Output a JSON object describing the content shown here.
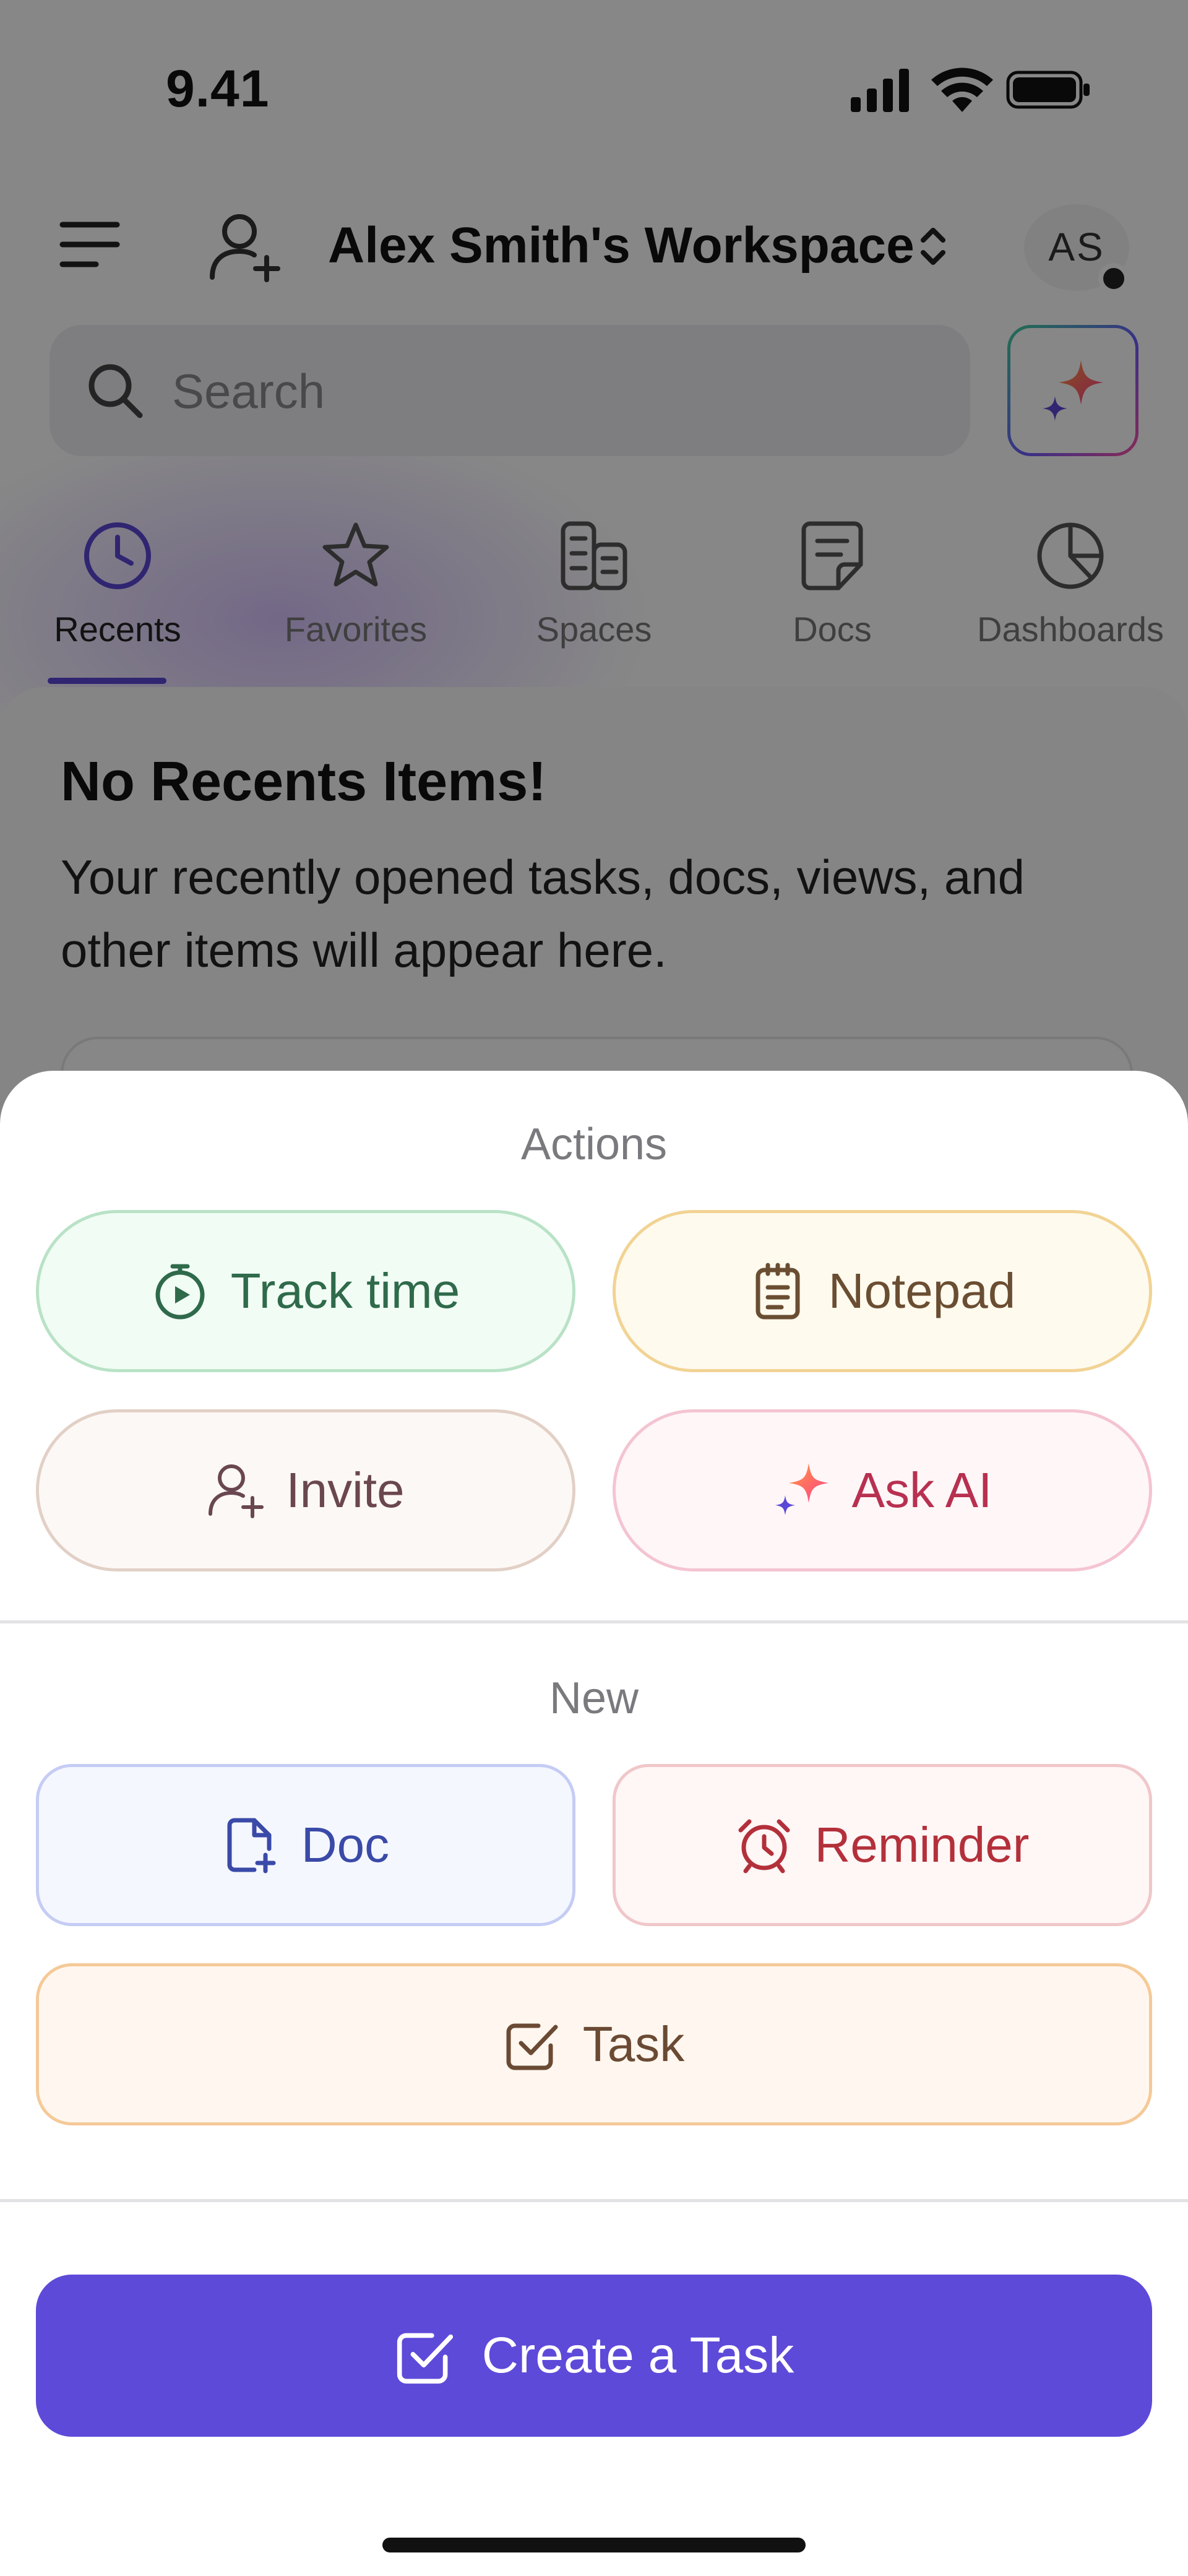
{
  "status_bar": {
    "time": "9.41"
  },
  "header": {
    "workspace_name": "Alex Smith's Workspace",
    "avatar_initials": "AS"
  },
  "search": {
    "placeholder": "Search"
  },
  "nav_tabs": [
    {
      "label": "Recents",
      "icon": "clock-icon",
      "active": true
    },
    {
      "label": "Favorites",
      "icon": "star-icon",
      "active": false
    },
    {
      "label": "Spaces",
      "icon": "spaces-icon",
      "active": false
    },
    {
      "label": "Docs",
      "icon": "doc-icon",
      "active": false
    },
    {
      "label": "Dashboards",
      "icon": "pie-chart-icon",
      "active": false
    }
  ],
  "empty_state": {
    "title": "No Recents Items!",
    "description": "Your recently opened tasks, docs, views, and other items will appear here."
  },
  "sheet": {
    "actions_title": "Actions",
    "actions": {
      "track_time": "Track time",
      "notepad": "Notepad",
      "invite": "Invite",
      "ask_ai": "Ask AI"
    },
    "new_title": "New",
    "new_items": {
      "doc": "Doc",
      "reminder": "Reminder",
      "task": "Task"
    },
    "primary_button": "Create a Task"
  },
  "colors": {
    "accent": "#5d4ad9",
    "track_time": "#2f6a4b",
    "notepad": "#6a4e32",
    "invite": "#6a4750",
    "ask_ai": "#b83050",
    "doc": "#3a4aa8",
    "reminder": "#b3303a",
    "task": "#6b4a34"
  }
}
